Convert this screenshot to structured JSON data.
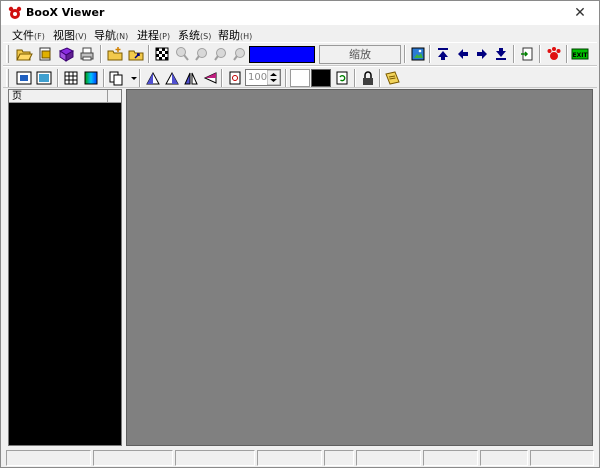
{
  "window": {
    "title": "BooX Viewer"
  },
  "menu": [
    {
      "label": "文件",
      "accel": "(F)"
    },
    {
      "label": "视图",
      "accel": "(V)"
    },
    {
      "label": "导航",
      "accel": "(N)"
    },
    {
      "label": "进程",
      "accel": "(P)"
    },
    {
      "label": "系统",
      "accel": "(S)"
    },
    {
      "label": "帮助",
      "accel": "(H)"
    }
  ],
  "toolbar1": {
    "zoom_label": "缩放",
    "exit_label": "EXIT",
    "color_value": "#0000ff"
  },
  "toolbar2": {
    "zoom_percent": "100",
    "bg_color": "#ffffff",
    "fg_color": "#000000"
  },
  "left_panel": {
    "column_header": "页"
  },
  "colors": {
    "window_bg": "#f0f0f0",
    "main_area": "#808080",
    "left_panel": "#000000",
    "accent_blue": "#0000ff"
  }
}
